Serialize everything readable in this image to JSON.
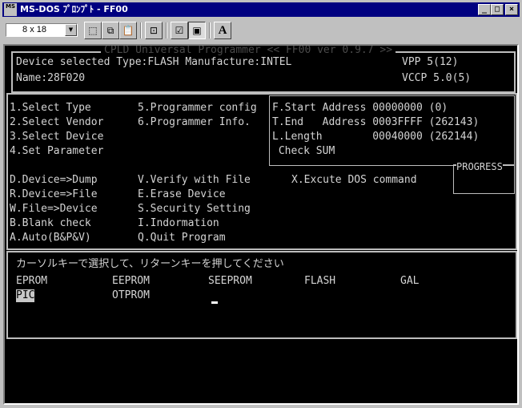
{
  "window": {
    "title": "MS-DOS ﾌﾟﾛﾝﾌﾟﾄ - FF00",
    "icon_text": "MS"
  },
  "toolbar": {
    "font_size": "8 x 18"
  },
  "program": {
    "banner": "CPLD Universal Programmer << FF00 ver 0.9.7 >>",
    "device_line": "Device selected Type:FLASH Manufacture:INTEL",
    "name_line": "Name:28F020",
    "vpp": "VPP 5(12)",
    "vccp": "VCCP 5.0(5)"
  },
  "menu_left": [
    "1.Select Type",
    "2.Select Vendor",
    "3.Select Device",
    "4.Set Parameter"
  ],
  "menu_mid": [
    "5.Programmer config",
    "6.Programmer Info."
  ],
  "address": [
    "F.Start Address 00000000 (0)",
    "T.End   Address 0003FFFF (262143)",
    "L.Length        00040000 (262144)",
    " Check SUM"
  ],
  "progress_label": "PROGRESS",
  "commands_left": [
    "D.Device=>Dump",
    "R.Device=>File",
    "W.File=>Device",
    "B.Blank check",
    "A.Auto(B&P&V)"
  ],
  "commands_mid": [
    "V.Verify with File",
    "E.Erase Device",
    "S.Security Setting",
    "I.Indormation",
    "Q.Quit Program"
  ],
  "commands_right": "X.Excute DOS command",
  "selector": {
    "prompt": "カーソルキーで選択して、リターンキーを押してください",
    "row1": [
      "EPROM",
      "EEPROM",
      "SEEPROM",
      "FLASH",
      "GAL"
    ],
    "row2": [
      "PIC",
      "OTPROM"
    ],
    "selected": "PIC"
  }
}
